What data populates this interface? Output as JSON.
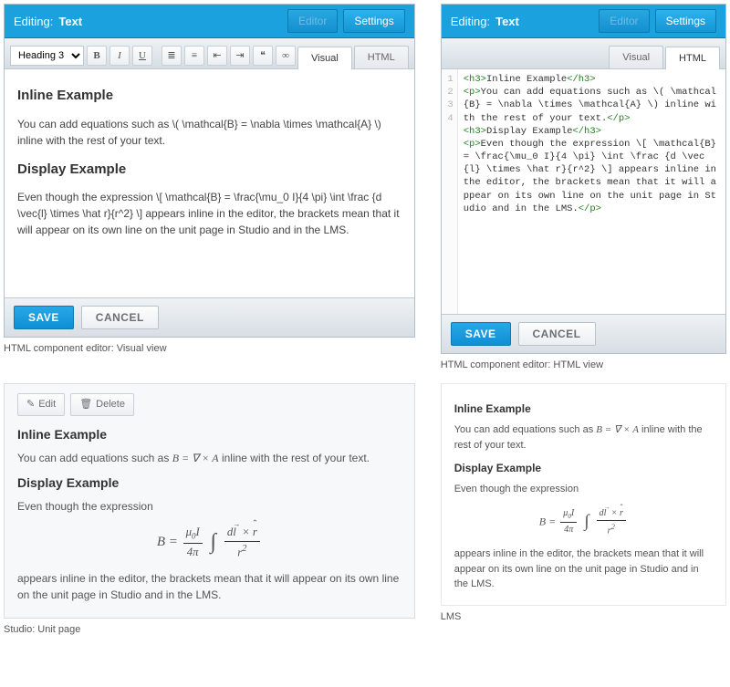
{
  "header": {
    "editing_label": "Editing:",
    "title": "Text",
    "editor_btn": "Editor",
    "settings_btn": "Settings"
  },
  "tabs": {
    "visual": "Visual",
    "html": "HTML"
  },
  "toolbar": {
    "format_select": "Heading 3"
  },
  "actions": {
    "save": "SAVE",
    "cancel": "CANCEL",
    "edit": "Edit",
    "delete": "Delete"
  },
  "captions": {
    "visual": "HTML component editor: Visual view",
    "html": "HTML component editor: HTML view",
    "studio": "Studio: Unit page",
    "lms": "LMS"
  },
  "content": {
    "h1": "Inline Example",
    "p1_visual": "You can add equations such as \\( \\mathcal{B} = \\nabla \\times \\mathcal{A} \\) inline with the rest of your text.",
    "h2": "Display Example",
    "p2_visual": "Even though the expression \\[ \\mathcal{B} = \\frac{\\mu_0 I}{4 \\pi} \\int \\frac {d \\vec{l} \\times \\hat r}{r^2} \\] appears inline in the editor, the brackets mean that it will appear on its own line on the unit page in Studio and in the LMS.",
    "p1_rendered_pre": "You can add equations such as ",
    "p1_rendered_post": " inline with the rest of your text.",
    "p2_rendered_pre": "Even though the expression",
    "p2_rendered_post": "appears inline in the editor, the brackets mean that it will appear on its own line on the unit page in Studio and in the LMS."
  },
  "source_lines": [
    {
      "n": "1",
      "html": "<span class='tag'>&lt;h3&gt;</span><span class='txt'>Inline Example</span><span class='tag'>&lt;/h3&gt;</span>"
    },
    {
      "n": "2",
      "html": "<span class='tag'>&lt;p&gt;</span><span class='txt'>You can add equations such as \\( \\mathcal{B} = \\nabla \\times \\mathcal{A} \\) inline with the rest of your text.</span><span class='tag'>&lt;/p&gt;</span>"
    },
    {
      "n": "3",
      "html": "<span class='tag'>&lt;h3&gt;</span><span class='txt'>Display Example</span><span class='tag'>&lt;/h3&gt;</span>"
    },
    {
      "n": "4",
      "html": "<span class='tag'>&lt;p&gt;</span><span class='txt'>Even though the expression \\[ \\mathcal{B} = \\frac{\\mu_0 I}{4 \\pi} \\int \\frac {d \\vec{l} \\times \\hat r}{r^2} \\] appears inline in the editor, the brackets mean that it will appear on its own line on the unit page in Studio and in the LMS.</span><span class='tag'>&lt;/p&gt;</span>"
    }
  ]
}
